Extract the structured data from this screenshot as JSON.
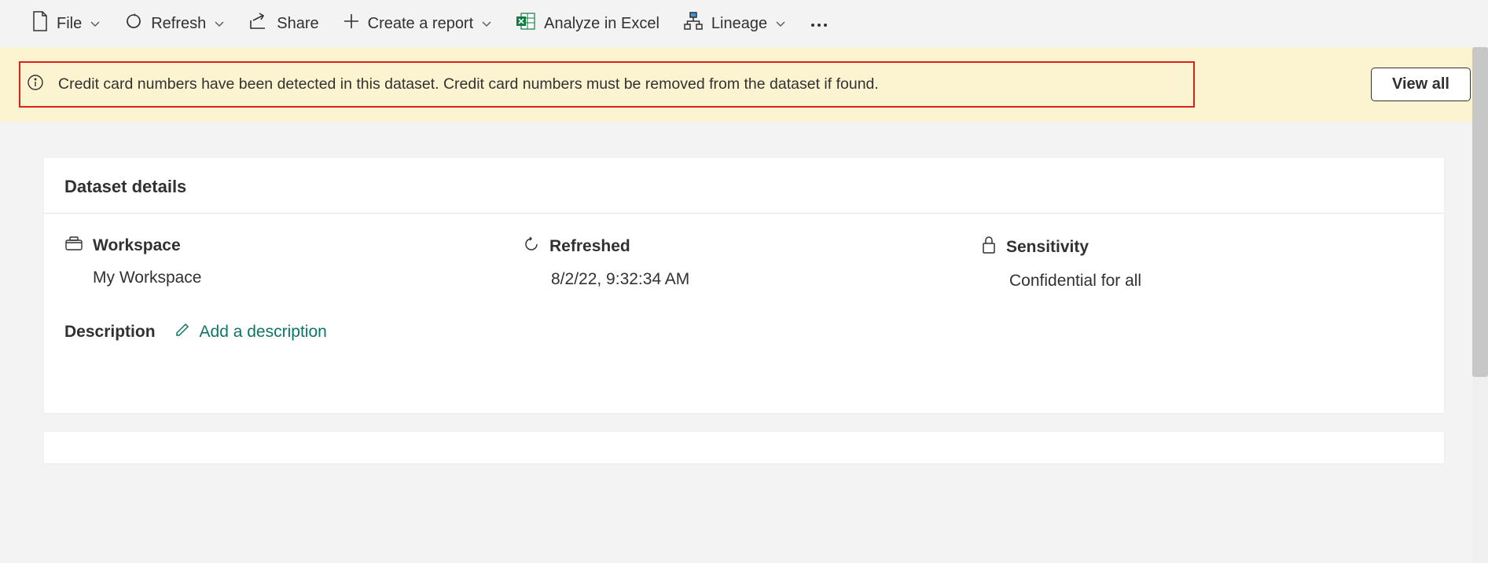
{
  "toolbar": {
    "file": "File",
    "refresh": "Refresh",
    "share": "Share",
    "create_report": "Create a report",
    "analyze_excel": "Analyze in Excel",
    "lineage": "Lineage"
  },
  "banner": {
    "message": "Credit card numbers have been detected in this dataset. Credit card numbers must be removed from the dataset if found.",
    "view_all": "View all"
  },
  "details": {
    "card_title": "Dataset details",
    "workspace_label": "Workspace",
    "workspace_value": "My Workspace",
    "refreshed_label": "Refreshed",
    "refreshed_value": "8/2/22, 9:32:34 AM",
    "sensitivity_label": "Sensitivity",
    "sensitivity_value": "Confidential for all",
    "description_label": "Description",
    "add_description": "Add a description"
  }
}
